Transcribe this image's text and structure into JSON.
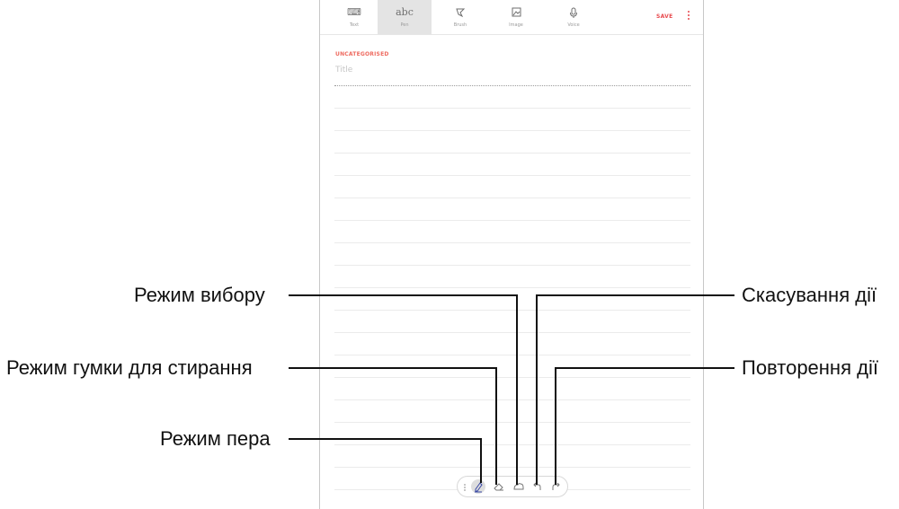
{
  "toolbar": {
    "items": [
      {
        "label": "Text",
        "icon": "keyboard-icon"
      },
      {
        "label": "Pen",
        "icon": "abc",
        "active": true
      },
      {
        "label": "Brush",
        "icon": "brush-icon"
      },
      {
        "label": "Image",
        "icon": "image-icon"
      },
      {
        "label": "Voice",
        "icon": "microphone-icon"
      }
    ],
    "abc_glyph": "abc",
    "save_label": "SAVE"
  },
  "note": {
    "category": "UNCATEGORISED",
    "title_placeholder": "Title"
  },
  "pen_toolbar": {
    "tools": [
      "pen-mode-icon",
      "eraser-icon",
      "selection-mode-icon",
      "undo-icon",
      "redo-icon"
    ],
    "selected": "pen-mode-icon"
  },
  "callouts": {
    "selection_mode": "Режим вибору",
    "eraser_mode": "Режим гумки для стирання",
    "pen_mode": "Режим пера",
    "undo": "Скасування дії",
    "redo": "Повторення дії"
  },
  "colors": {
    "accent": "#e8494d",
    "category": "#ee6a5f",
    "pen_selected": "#3b4aa6"
  }
}
